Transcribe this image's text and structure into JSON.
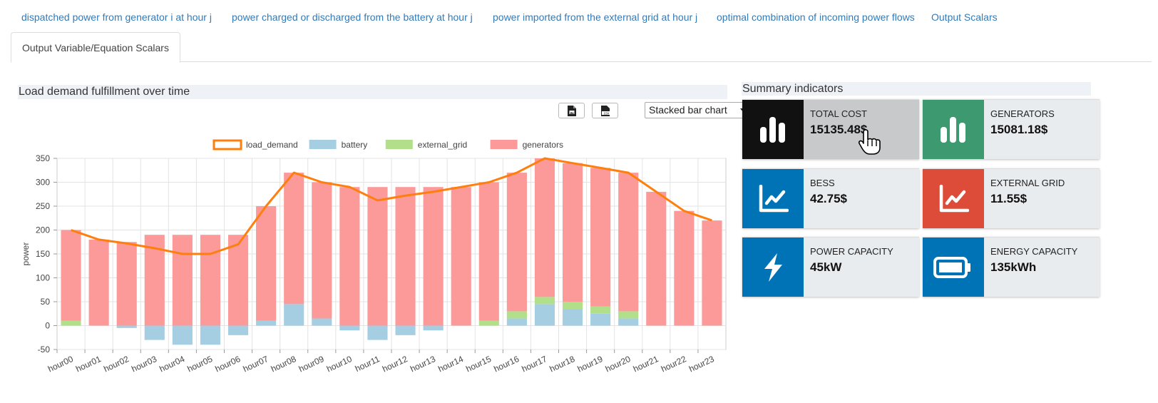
{
  "tabs": {
    "items": [
      {
        "label": "dispatched power from generator i at hour j"
      },
      {
        "label": "power charged or discharged from the battery at hour j"
      },
      {
        "label": "power imported from the external grid at hour j"
      },
      {
        "label": "optimal combination of incoming power flows"
      },
      {
        "label": "Output Scalars"
      }
    ],
    "active_label": "Output Variable/Equation Scalars"
  },
  "left_panel": {
    "title": "Load demand fulfillment over time",
    "download_image_icon": "image-file-icon",
    "download_csv_icon": "csv-file-icon",
    "chart_type_selected": "Stacked bar chart"
  },
  "right_panel": {
    "title": "Summary indicators",
    "cards": [
      {
        "label": "TOTAL COST",
        "value": "15135.48$",
        "icon": "bar-chart-icon",
        "color": "#111111"
      },
      {
        "label": "GENERATORS",
        "value": "15081.18$",
        "icon": "bar-chart-icon",
        "color": "#3d9970"
      },
      {
        "label": "BESS",
        "value": "42.75$",
        "icon": "line-chart-icon",
        "color": "#0073b7"
      },
      {
        "label": "EXTERNAL GRID",
        "value": "11.55$",
        "icon": "line-chart-icon",
        "color": "#dd4b39"
      },
      {
        "label": "POWER CAPACITY",
        "value": "45kW",
        "icon": "bolt-icon",
        "color": "#0073b7"
      },
      {
        "label": "ENERGY CAPACITY",
        "value": "135kWh",
        "icon": "battery-icon",
        "color": "#0073b7"
      }
    ]
  },
  "chart_data": {
    "type": "bar",
    "stacked": true,
    "ylabel": "power",
    "xlabel": "",
    "ylim": [
      -50,
      350
    ],
    "yticks": [
      -50,
      0,
      50,
      100,
      150,
      200,
      250,
      300,
      350
    ],
    "grid": true,
    "legend_position": "top",
    "categories": [
      "hour00",
      "hour01",
      "hour02",
      "hour03",
      "hour04",
      "hour05",
      "hour06",
      "hour07",
      "hour08",
      "hour09",
      "hour10",
      "hour11",
      "hour12",
      "hour13",
      "hour14",
      "hour15",
      "hour16",
      "hour17",
      "hour18",
      "hour19",
      "hour20",
      "hour21",
      "hour22",
      "hour23"
    ],
    "series": [
      {
        "name": "load_demand",
        "kind": "line",
        "color": "#ff7f0e",
        "values": [
          200,
          180,
          172,
          162,
          150,
          150,
          170,
          250,
          320,
          300,
          290,
          262,
          272,
          280,
          290,
          300,
          320,
          350,
          340,
          330,
          320,
          280,
          240,
          220
        ]
      },
      {
        "name": "battery",
        "kind": "bar",
        "color": "#a6cee3",
        "values": [
          0,
          0,
          -5,
          -30,
          -40,
          -40,
          -20,
          10,
          45,
          15,
          -10,
          -30,
          -20,
          -10,
          0,
          0,
          15,
          45,
          35,
          25,
          15,
          0,
          0,
          0
        ]
      },
      {
        "name": "external_grid",
        "kind": "bar",
        "color": "#b2df8a",
        "values": [
          10,
          0,
          0,
          0,
          0,
          0,
          0,
          0,
          0,
          0,
          0,
          0,
          0,
          0,
          0,
          10,
          15,
          15,
          15,
          15,
          15,
          0,
          0,
          0
        ]
      },
      {
        "name": "generators",
        "kind": "bar",
        "color": "#fb9a99",
        "values": [
          190,
          180,
          175,
          190,
          190,
          190,
          190,
          240,
          275,
          285,
          290,
          290,
          290,
          290,
          290,
          290,
          290,
          290,
          290,
          290,
          290,
          280,
          240,
          220
        ]
      }
    ]
  }
}
